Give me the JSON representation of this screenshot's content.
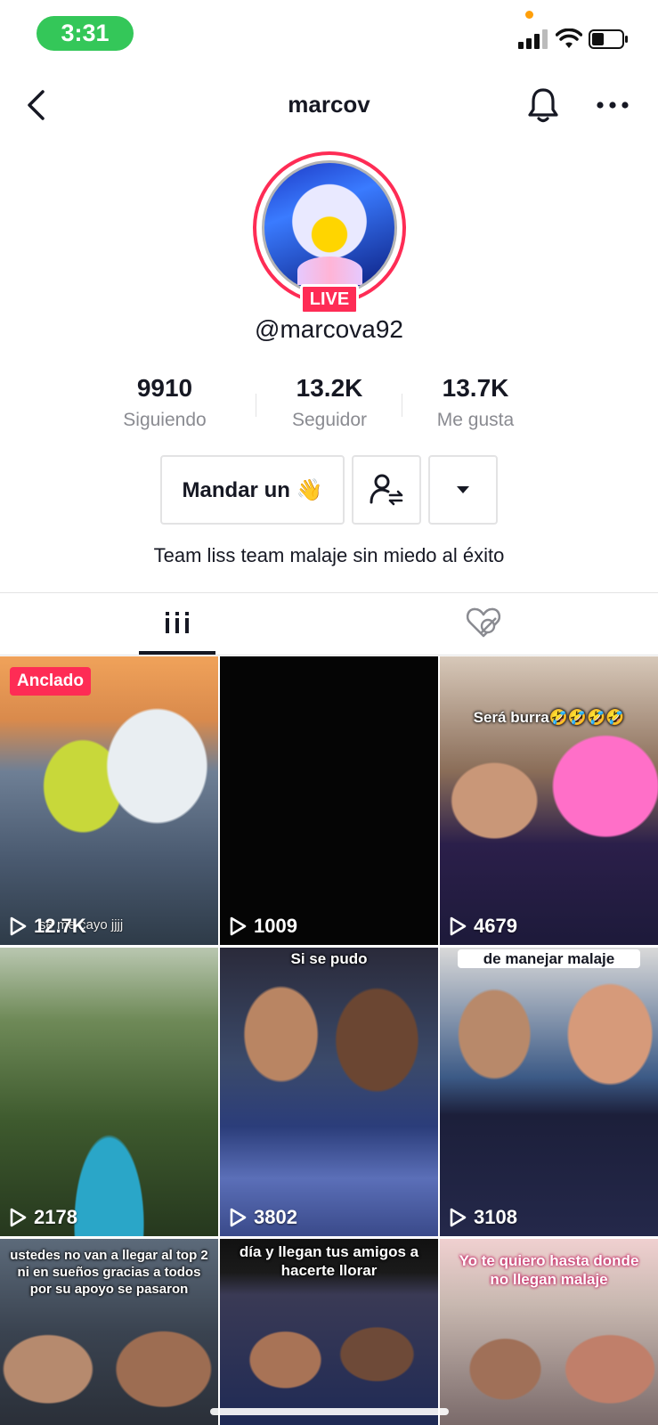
{
  "status_bar": {
    "time": "3:31"
  },
  "nav": {
    "title": "marcov",
    "icons": [
      "back-icon",
      "bell-icon",
      "more-icon"
    ]
  },
  "profile": {
    "live_label": "LIVE",
    "handle": "@marcova92",
    "bio": "Team liss team malaje sin miedo al éxito"
  },
  "stats": {
    "following": {
      "value": "9910",
      "label": "Siguiendo"
    },
    "followers": {
      "value": "13.2K",
      "label": "Seguidor"
    },
    "likes": {
      "value": "13.7K",
      "label": "Me gusta"
    }
  },
  "actions": {
    "message_label": "Mandar un 👋"
  },
  "tabs": [
    "videos-grid-icon",
    "liked-hidden-icon"
  ],
  "videos": [
    {
      "views": "12.7K",
      "pinned": "Anclado",
      "caption": "se me cayo jjjj"
    },
    {
      "views": "1009"
    },
    {
      "views": "4679",
      "overlay": "Será burra🤣🤣🤣🤣"
    },
    {
      "views": "2178"
    },
    {
      "views": "3802",
      "overlay": "Si se pudo"
    },
    {
      "views": "3108",
      "overlay": "de manejar malaje"
    },
    {
      "overlay": "ustedes no van a llegar al top 2 ni en sueños gracias a todos por su apoyo se pasaron"
    },
    {
      "overlay": "día y llegan tus amigos a hacerte llorar"
    },
    {
      "overlay": "Yo te quiero hasta donde no llegan malaje"
    }
  ],
  "colors": {
    "live_red": "#fe2c55",
    "status_green": "#34c759",
    "text_primary": "#161823",
    "text_secondary": "#8a8b91"
  }
}
